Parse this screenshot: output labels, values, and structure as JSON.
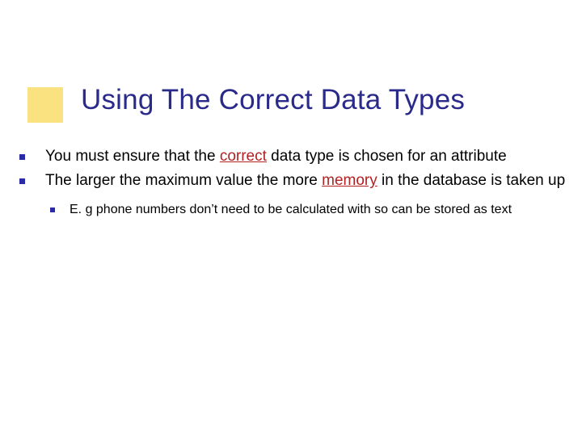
{
  "slide": {
    "title": "Using The Correct Data Types",
    "bullets": [
      {
        "prefix": "You must ensure that the ",
        "emph": "correct",
        "suffix": " data type is chosen for an attribute"
      },
      {
        "prefix": "The larger the maximum value the more ",
        "emph": "memory",
        "suffix": " in the database is taken up",
        "sub": [
          {
            "text": "E. g phone numbers don’t need to be calculated with so can be stored as text"
          }
        ]
      }
    ]
  }
}
